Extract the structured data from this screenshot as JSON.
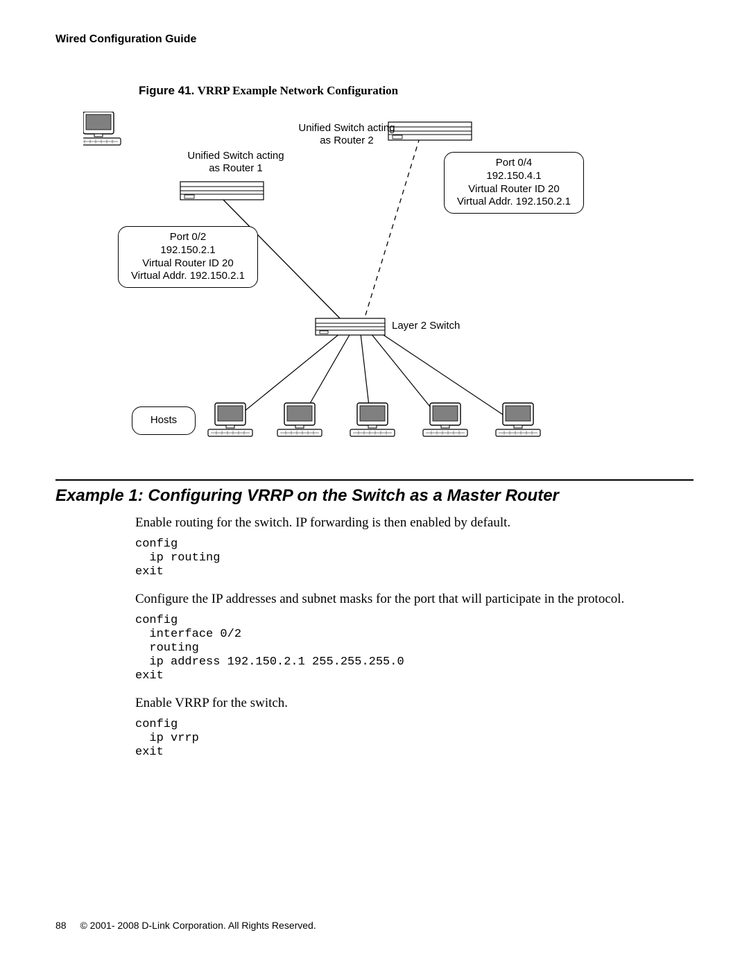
{
  "header": {
    "title": "Wired Configuration Guide"
  },
  "figure": {
    "number": "Figure 41.",
    "title": "VRRP Example Network Configuration",
    "labels": {
      "router1": "Unified Switch acting\nas Router 1",
      "router2": "Unified Switch acting\nas Router 2",
      "l2switch": "Layer 2 Switch",
      "hosts": "Hosts"
    },
    "boxes": {
      "left": {
        "l1": "Port 0/2",
        "l2": "192.150.2.1",
        "l3": "Virtual Router ID  20",
        "l4": "Virtual Addr. 192.150.2.1"
      },
      "right": {
        "l1": "Port 0/4",
        "l2": "192.150.4.1",
        "l3": "Virtual Router ID  20",
        "l4": "Virtual Addr. 192.150.2.1"
      }
    }
  },
  "section": {
    "title": "Example 1: Configuring VRRP on the Switch as a Master Router",
    "p1": "Enable routing for the switch. IP forwarding is then enabled by default.",
    "code1": "config\n  ip routing\nexit",
    "p2": "Configure the IP addresses and subnet masks for the port that will participate in the protocol.",
    "code2": "config\n  interface 0/2\n  routing\n  ip address 192.150.2.1 255.255.255.0\nexit",
    "p3": "Enable VRRP for the switch.",
    "code3": "config\n  ip vrrp\nexit"
  },
  "footer": {
    "page": "88",
    "copyright": "© 2001- 2008 D-Link Corporation. All Rights Reserved."
  }
}
